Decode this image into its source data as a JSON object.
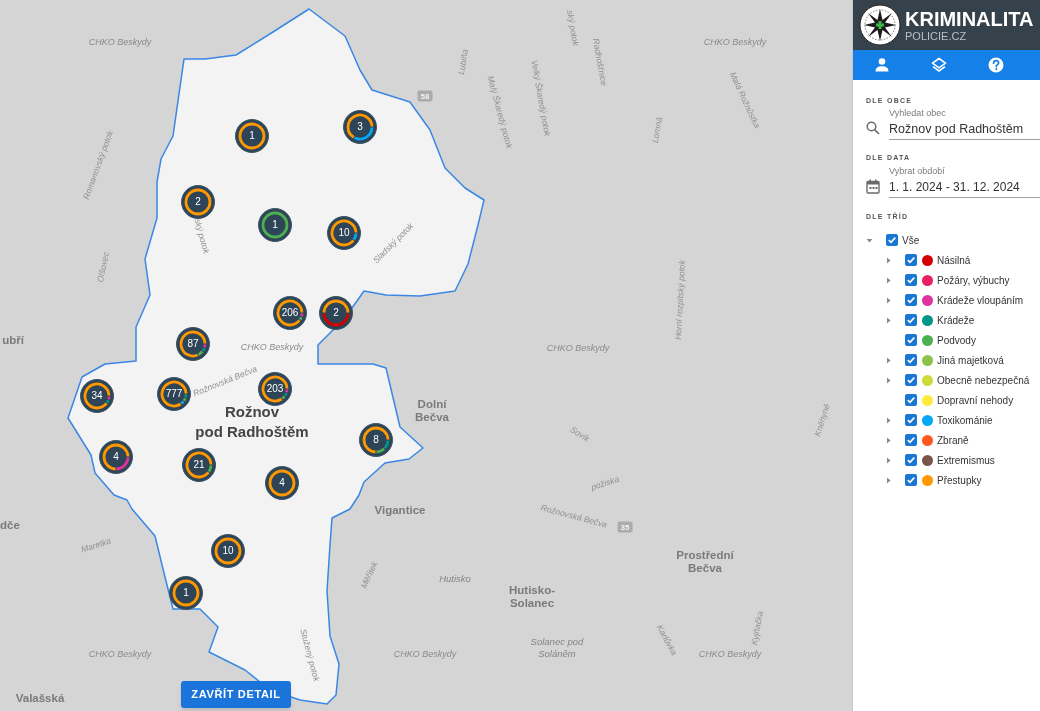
{
  "map": {
    "labels": [
      {
        "text": "ský potok",
        "kind": "water"
      },
      {
        "text": "CHKO Beskydy",
        "kind": "area"
      },
      {
        "text": "CHKO Beskydy",
        "kind": "area"
      },
      {
        "text": "Lubiňa",
        "kind": "water"
      },
      {
        "text": "Radhošťnice",
        "kind": "water"
      },
      {
        "text": "Velký Škaredý potok",
        "kind": "water"
      },
      {
        "text": "58",
        "kind": "road"
      },
      {
        "text": "Malý Škaredý potok",
        "kind": "water"
      },
      {
        "text": "Malá Rožnůstka",
        "kind": "water"
      },
      {
        "text": "Lomná",
        "kind": "water"
      },
      {
        "text": "Romanovský potok",
        "kind": "water"
      },
      {
        "text": "ský potok",
        "kind": "water"
      },
      {
        "text": "Sladský potok",
        "kind": "water"
      },
      {
        "text": "Olšovec",
        "kind": "water"
      },
      {
        "text": "Horní rozpitský potok",
        "kind": "water"
      },
      {
        "text": "ubří",
        "kind": "town"
      },
      {
        "text": "CHKO Beskydy",
        "kind": "area"
      },
      {
        "text": "CHKO Beskydy",
        "kind": "area"
      },
      {
        "text": "Rožnovská Bečva",
        "kind": "water"
      },
      {
        "text": "Dolní\nBečva",
        "kind": "town"
      },
      {
        "text": "Kněhyně",
        "kind": "water"
      },
      {
        "text": "Rožnov\npod Radhoštěm",
        "kind": "city"
      },
      {
        "text": "Sovík",
        "kind": "water"
      },
      {
        "text": "požiska",
        "kind": "water"
      },
      {
        "text": "Vigantice",
        "kind": "town"
      },
      {
        "text": "Rožnovská Bečva",
        "kind": "water"
      },
      {
        "text": "dče",
        "kind": "town"
      },
      {
        "text": "35",
        "kind": "road"
      },
      {
        "text": "Maretka",
        "kind": "water"
      },
      {
        "text": "Prostřední\nBečva",
        "kind": "town"
      },
      {
        "text": "Měřítek",
        "kind": "water"
      },
      {
        "text": "Hutisko",
        "kind": "locality"
      },
      {
        "text": "Hutisko-\nSolanec",
        "kind": "town"
      },
      {
        "text": "Kyjňačka",
        "kind": "water"
      },
      {
        "text": "CHKO Beskydy",
        "kind": "area"
      },
      {
        "text": "Stužený potok",
        "kind": "water"
      },
      {
        "text": "CHKO Beskydy",
        "kind": "area"
      },
      {
        "text": "Solanec pod\nSoláněm",
        "kind": "locality"
      },
      {
        "text": "Karlůvka",
        "kind": "water"
      },
      {
        "text": "CHKO Beskydy",
        "kind": "area"
      },
      {
        "text": "Valašská",
        "kind": "town"
      }
    ],
    "clusters": [
      {
        "count": "1",
        "segments": [
          {
            "color": "#ff9800"
          }
        ]
      },
      {
        "count": "3",
        "segments": [
          {
            "color": "#03a9f4"
          },
          {
            "color": "#ff9800"
          }
        ]
      },
      {
        "count": "2",
        "segments": [
          {
            "color": "#ff9800"
          }
        ]
      },
      {
        "count": "1",
        "segments": [
          {
            "color": "#4caf50"
          }
        ]
      },
      {
        "count": "10",
        "segments": [
          {
            "color": "#03a9f4"
          },
          {
            "color": "#ff9800"
          }
        ]
      },
      {
        "count": "206",
        "segments": [
          {
            "color": "#e0339f"
          },
          {
            "color": "#4caf50"
          },
          {
            "color": "#ff9800"
          }
        ]
      },
      {
        "count": "2",
        "segments": [
          {
            "color": "#d50000"
          },
          {
            "color": "#ff9800"
          }
        ]
      },
      {
        "count": "87",
        "segments": [
          {
            "color": "#e0339f"
          },
          {
            "color": "#009688"
          },
          {
            "color": "#4caf50"
          },
          {
            "color": "#ff9800"
          }
        ]
      },
      {
        "count": "34",
        "segments": [
          {
            "color": "#e0339f"
          },
          {
            "color": "#009688"
          },
          {
            "color": "#ff9800"
          }
        ]
      },
      {
        "count": "777",
        "segments": [
          {
            "color": "#009688"
          },
          {
            "color": "#4caf50"
          },
          {
            "color": "#03a9f4"
          },
          {
            "color": "#ff9800"
          }
        ]
      },
      {
        "count": "203",
        "segments": [
          {
            "color": "#e0339f"
          },
          {
            "color": "#009688"
          },
          {
            "color": "#4caf50"
          },
          {
            "color": "#ff9800"
          }
        ]
      },
      {
        "count": "8",
        "segments": [
          {
            "color": "#009688"
          },
          {
            "color": "#4caf50"
          },
          {
            "color": "#ff9800"
          }
        ]
      },
      {
        "count": "4",
        "segments": [
          {
            "color": "#e0339f"
          },
          {
            "color": "#ff9800"
          }
        ]
      },
      {
        "count": "21",
        "segments": [
          {
            "color": "#4caf50"
          },
          {
            "color": "#ff9800"
          }
        ]
      },
      {
        "count": "4",
        "segments": [
          {
            "color": "#ff9800"
          }
        ]
      },
      {
        "count": "10",
        "segments": [
          {
            "color": "#ff9800"
          }
        ]
      },
      {
        "count": "1",
        "segments": [
          {
            "color": "#ff9800"
          }
        ]
      }
    ],
    "close_button": "ZAVŘÍT DETAIL"
  },
  "sidebar": {
    "header": {
      "title": "KRIMINALITA",
      "subtitle": "POLICIE.CZ"
    },
    "tabs": [
      {
        "kind": "person"
      },
      {
        "kind": "layers"
      },
      {
        "kind": "help"
      }
    ],
    "municipality": {
      "heading": "DLE OBCE",
      "label": "Vyhledat obec",
      "value": "Rožnov pod Radhoštěm"
    },
    "period": {
      "heading": "DLE DATA",
      "label": "Vybrat období",
      "value": "1. 1. 2024 - 31. 12. 2024"
    },
    "categories": {
      "heading": "DLE TŘÍD",
      "tree": [
        {
          "label": "Vše",
          "checked": true,
          "expanded": true,
          "children": [
            {
              "label": "Násilná",
              "kind": "group",
              "expanded": false,
              "checked": true,
              "color": "#d50000"
            },
            {
              "label": "Požáry, výbuchy",
              "kind": "group",
              "expanded": false,
              "checked": true,
              "color": "#e91e63"
            },
            {
              "label": "Krádeže vloupáním",
              "kind": "group",
              "expanded": false,
              "checked": true,
              "color": "#e0339f"
            },
            {
              "label": "Krádeže",
              "kind": "group",
              "expanded": false,
              "checked": true,
              "color": "#009688"
            },
            {
              "label": "Podvody",
              "kind": "leaf",
              "checked": true,
              "color": "#4caf50"
            },
            {
              "label": "Jiná majetková",
              "kind": "group",
              "expanded": false,
              "checked": true,
              "color": "#8bc34a"
            },
            {
              "label": "Obecně nebezpečná",
              "kind": "group",
              "expanded": false,
              "checked": true,
              "color": "#cddc39"
            },
            {
              "label": "Dopravní nehody",
              "kind": "leaf",
              "checked": true,
              "color": "#ffeb3b"
            },
            {
              "label": "Toxikománie",
              "kind": "group",
              "expanded": false,
              "checked": true,
              "color": "#03a9f4"
            },
            {
              "label": "Zbraně",
              "kind": "group",
              "expanded": false,
              "checked": true,
              "color": "#ff5722"
            },
            {
              "label": "Extremismus",
              "kind": "group",
              "expanded": false,
              "checked": true,
              "color": "#795548"
            },
            {
              "label": "Přestupky",
              "kind": "group",
              "expanded": false,
              "checked": true,
              "color": "#ff9800"
            }
          ]
        }
      ]
    }
  }
}
